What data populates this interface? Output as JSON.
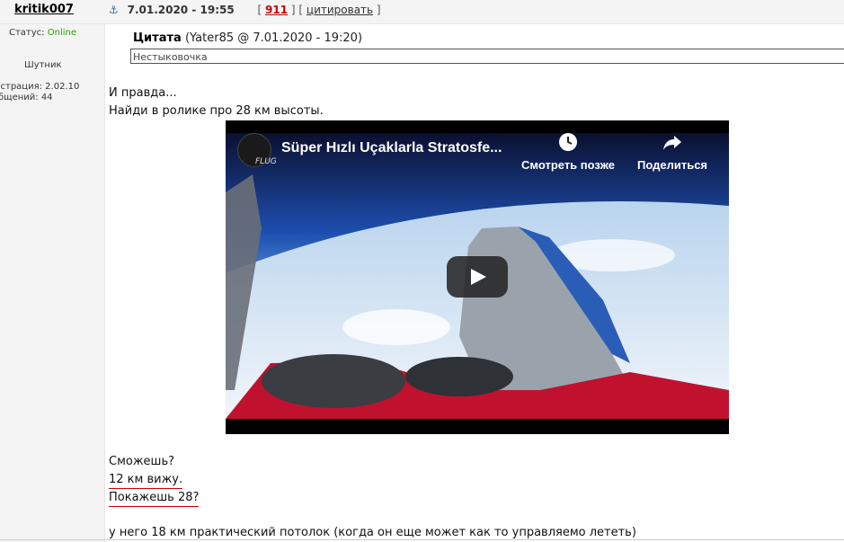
{
  "author": {
    "username": "kritik007",
    "status_label": "Статус:",
    "status_value": "Online",
    "rank": "Шутник",
    "registered": "истрация: 2.02.10",
    "messages": "бщений: 44"
  },
  "post": {
    "anchor_icon": "⚓",
    "date": "7.01.2020 - 19:55",
    "number": "911",
    "quote_link": "цитировать"
  },
  "quote": {
    "label": "Цитата",
    "source": "(Yater85 @ 7.01.2020 - 19:20)",
    "text": "Нестыковочка"
  },
  "body": {
    "line1": "И правда...",
    "line2": "Найди в ролике про 28 км высоты.",
    "line3": "Сможешь?",
    "line4": "12 км вижу.",
    "line5": "Покажешь 28?",
    "line6": "у него 18 км практический потолок (когда он еще может как то управляемо лететь)"
  },
  "video": {
    "title": "Süper Hızlı Uçaklarla Stratosfe...",
    "channel_logo_text": "FLUG",
    "watch_later": "Смотреть позже",
    "share": "Поделиться",
    "play_icon": "play-icon"
  }
}
